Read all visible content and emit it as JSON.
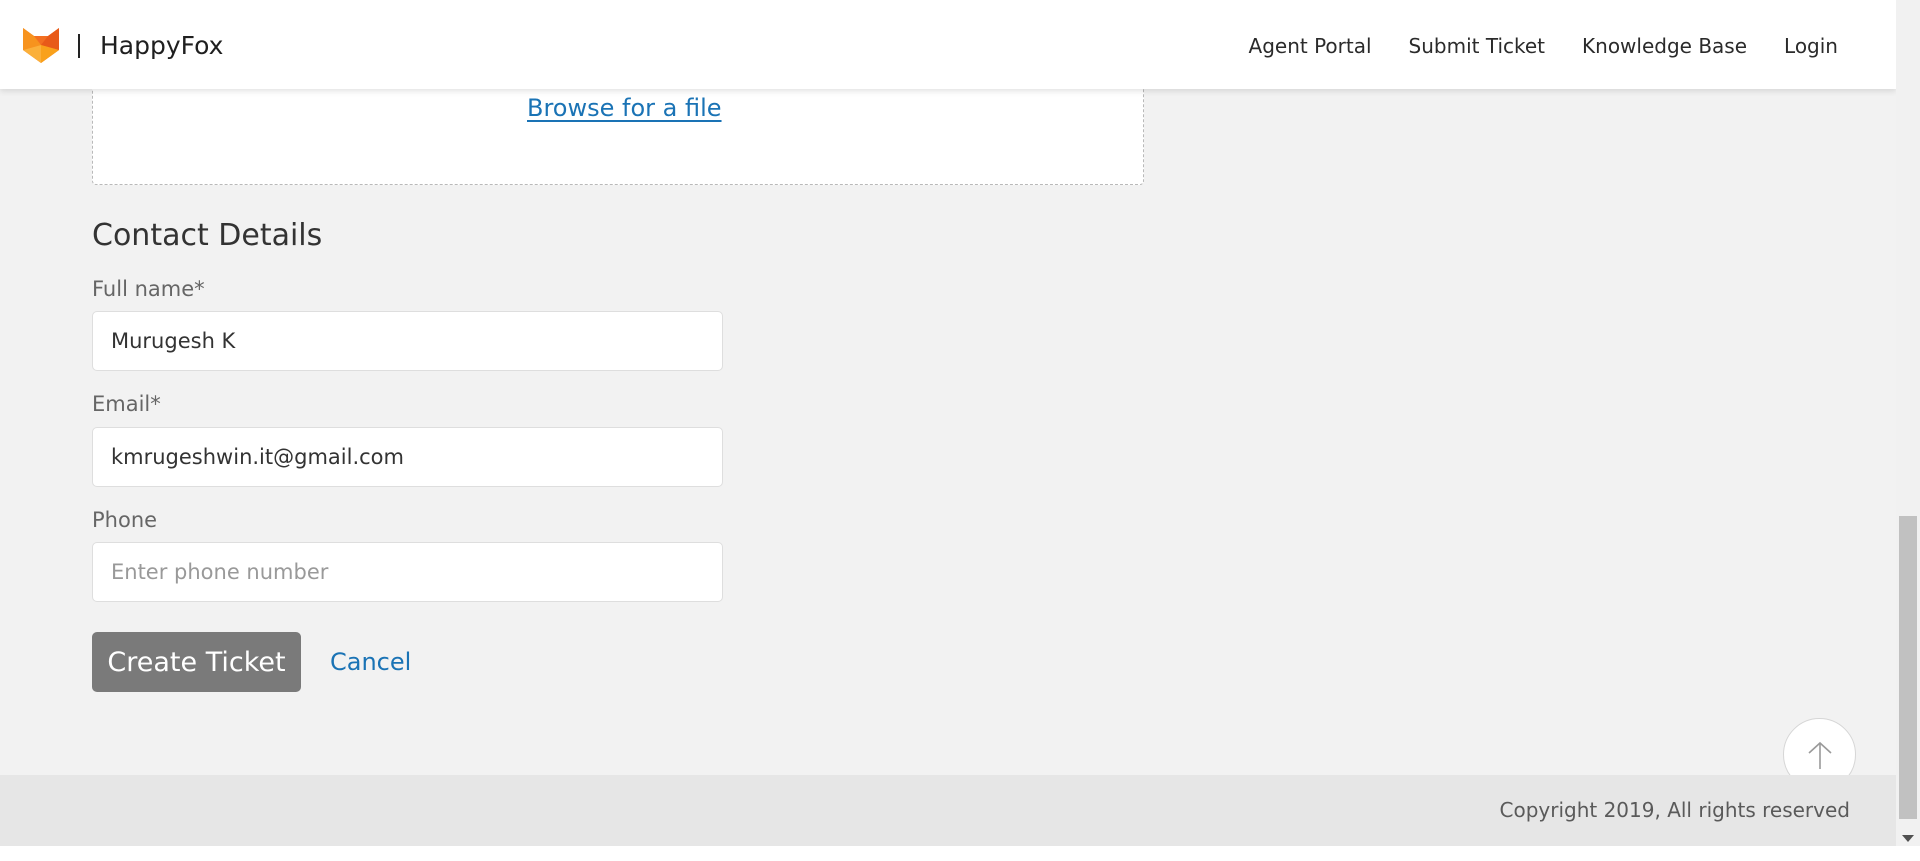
{
  "header": {
    "brand": "HappyFox",
    "nav": {
      "agent_portal": "Agent Portal",
      "submit_ticket": "Submit Ticket",
      "knowledge_base": "Knowledge Base",
      "login": "Login"
    }
  },
  "upload": {
    "browse_label": "Browse for a file"
  },
  "contact": {
    "title": "Contact Details",
    "full_name_label": "Full name*",
    "full_name_value": "Murugesh K",
    "email_label": "Email*",
    "email_value": "kmrugeshwin.it@gmail.com",
    "phone_label": "Phone",
    "phone_placeholder": "Enter phone number"
  },
  "actions": {
    "create_label": "Create Ticket",
    "cancel_label": "Cancel"
  },
  "footer": {
    "copyright": "Copyright 2019, All rights reserved"
  },
  "colors": {
    "accent_link": "#1a73b5",
    "primary_button": "#7a7a7a",
    "logo_orange": "#f36f21"
  },
  "icons": {
    "logo": "happyfox-fox-logo",
    "scroll_top": "arrow-up-icon"
  }
}
